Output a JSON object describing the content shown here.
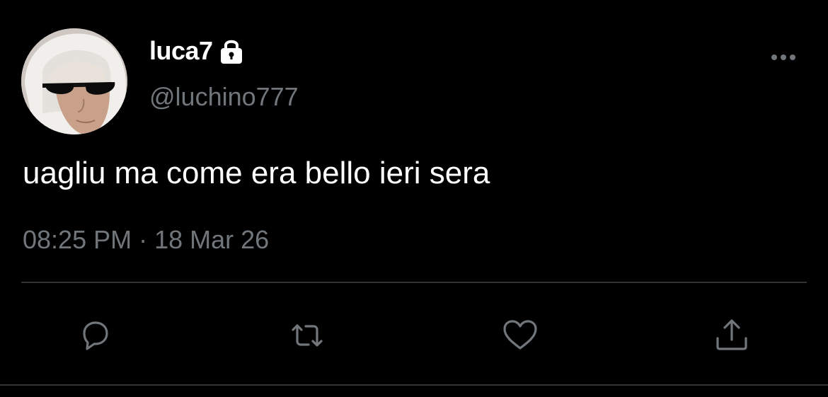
{
  "user": {
    "display_name": "luca7",
    "handle": "@luchino777",
    "protected": true
  },
  "tweet": {
    "text": "uagliu ma come era bello ieri sera",
    "timestamp": "08:25 PM · 18 Mar 26"
  },
  "actions": {
    "reply_icon": "speech-bubble-icon",
    "retweet_icon": "retweet-arrows-icon",
    "like_icon": "heart-icon",
    "share_icon": "share-upload-icon"
  },
  "colors": {
    "background": "#000000",
    "primary_text": "#ffffff",
    "secondary_text": "#71767b",
    "divider": "#2f3336"
  }
}
